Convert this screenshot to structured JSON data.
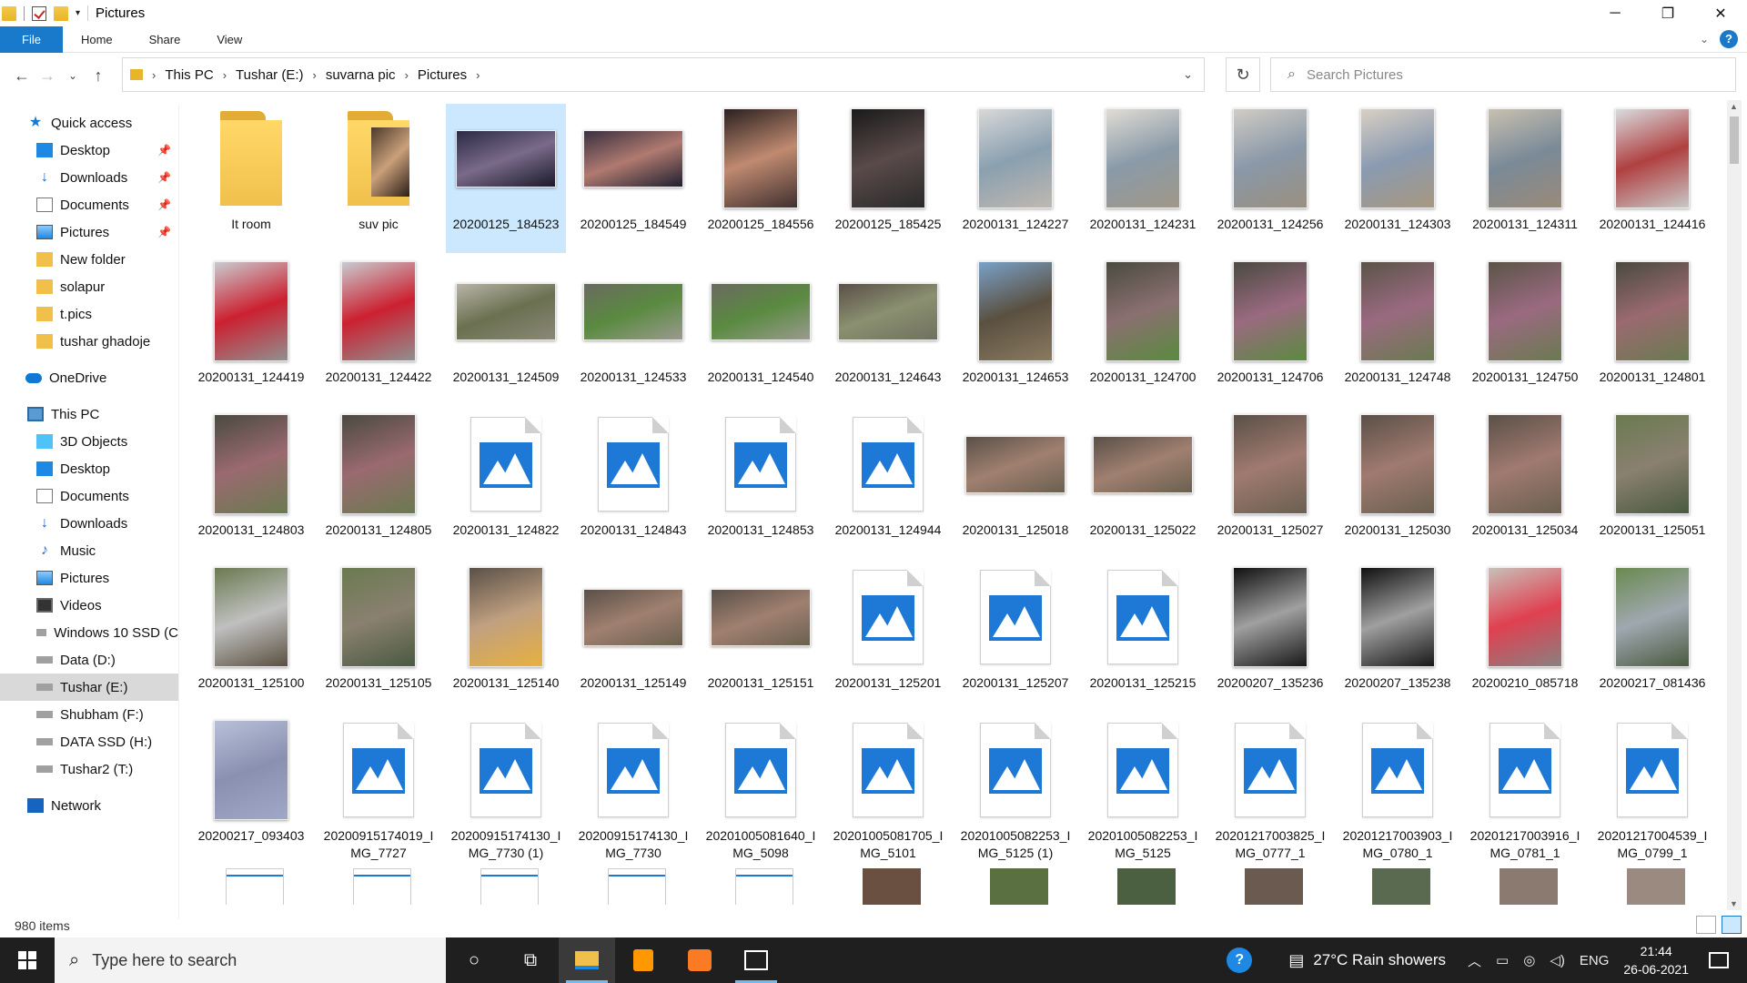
{
  "window": {
    "title": "Pictures",
    "controls": {
      "minimize": "─",
      "maximize": "❐",
      "close": "✕"
    }
  },
  "ribbon": {
    "tabs": [
      "File",
      "Home",
      "Share",
      "View"
    ]
  },
  "address": {
    "crumbs": [
      "This PC",
      "Tushar (E:)",
      "suvarna pic",
      "Pictures"
    ],
    "search_placeholder": "Search Pictures"
  },
  "sidebar": {
    "quick_access": "Quick access",
    "quick_items": [
      {
        "label": "Desktop",
        "icon": "desktop-icon",
        "pinned": true
      },
      {
        "label": "Downloads",
        "icon": "downloads-icon",
        "pinned": true
      },
      {
        "label": "Documents",
        "icon": "documents-icon",
        "pinned": true
      },
      {
        "label": "Pictures",
        "icon": "pictures-icon",
        "pinned": true
      },
      {
        "label": "New folder",
        "icon": "folder-icon",
        "pinned": false
      },
      {
        "label": "solapur",
        "icon": "folder-icon",
        "pinned": false
      },
      {
        "label": "t.pics",
        "icon": "folder-icon",
        "pinned": false
      },
      {
        "label": "tushar ghadoje",
        "icon": "folder-icon",
        "pinned": false
      }
    ],
    "onedrive": "OneDrive",
    "this_pc": "This PC",
    "pc_items": [
      {
        "label": "3D Objects",
        "icon": "3d-objects-icon"
      },
      {
        "label": "Desktop",
        "icon": "desktop-icon"
      },
      {
        "label": "Documents",
        "icon": "documents-icon"
      },
      {
        "label": "Downloads",
        "icon": "downloads-icon"
      },
      {
        "label": "Music",
        "icon": "music-icon"
      },
      {
        "label": "Pictures",
        "icon": "pictures-icon"
      },
      {
        "label": "Videos",
        "icon": "videos-icon"
      },
      {
        "label": "Windows 10 SSD (C",
        "icon": "drive-icon"
      },
      {
        "label": "Data (D:)",
        "icon": "drive-icon"
      },
      {
        "label": "Tushar (E:)",
        "icon": "drive-icon",
        "selected": true
      },
      {
        "label": "Shubham (F:)",
        "icon": "drive-icon"
      },
      {
        "label": "DATA SSD (H:)",
        "icon": "drive-icon"
      },
      {
        "label": "Tushar2 (T:)",
        "icon": "drive-icon"
      }
    ],
    "network": "Network"
  },
  "files": [
    {
      "name": "It room",
      "kind": "folder"
    },
    {
      "name": "suv pic",
      "kind": "folder-photo"
    },
    {
      "name": "20200125_184523",
      "kind": "l",
      "selected": true,
      "c": [
        "#2a2a45",
        "#7a6a8a",
        "#1a1a2a"
      ]
    },
    {
      "name": "20200125_184549",
      "kind": "l",
      "c": [
        "#3a3040",
        "#b07a70",
        "#202030"
      ]
    },
    {
      "name": "20200125_184556",
      "kind": "p",
      "c": [
        "#2a2020",
        "#c08a70",
        "#403030"
      ]
    },
    {
      "name": "20200125_185425",
      "kind": "p",
      "c": [
        "#1a1a1a",
        "#5a4a4a",
        "#2a2a2a"
      ]
    },
    {
      "name": "20200131_124227",
      "kind": "p",
      "c": [
        "#d8d8d8",
        "#8aa0b0",
        "#c0b8b0"
      ]
    },
    {
      "name": "20200131_124231",
      "kind": "p",
      "c": [
        "#e0dcd4",
        "#8a9aa8",
        "#a09888"
      ]
    },
    {
      "name": "20200131_124256",
      "kind": "p",
      "c": [
        "#d0ccc4",
        "#8a98a8",
        "#9a9080"
      ]
    },
    {
      "name": "20200131_124303",
      "kind": "p",
      "c": [
        "#d8d0c4",
        "#8a9ab0",
        "#a89880"
      ]
    },
    {
      "name": "20200131_124311",
      "kind": "p",
      "c": [
        "#c8c0b0",
        "#7a8a98",
        "#9a8a78"
      ]
    },
    {
      "name": "20200131_124416",
      "kind": "p",
      "c": [
        "#d8dce0",
        "#b04040",
        "#c8c8c8"
      ]
    },
    {
      "name": "20200131_124419",
      "kind": "p",
      "c": [
        "#c8ccd0",
        "#cc2030",
        "#909090"
      ]
    },
    {
      "name": "20200131_124422",
      "kind": "p",
      "c": [
        "#c8ccd0",
        "#cc2030",
        "#909090"
      ]
    },
    {
      "name": "20200131_124509",
      "kind": "l",
      "c": [
        "#b8b4a8",
        "#6a7050",
        "#8a8878"
      ]
    },
    {
      "name": "20200131_124533",
      "kind": "l",
      "c": [
        "#6a6a60",
        "#5a8a40",
        "#9a9a90"
      ]
    },
    {
      "name": "20200131_124540",
      "kind": "l",
      "c": [
        "#6a6a60",
        "#5a8a40",
        "#9a9a90"
      ]
    },
    {
      "name": "20200131_124643",
      "kind": "l",
      "c": [
        "#5a5048",
        "#8a9070",
        "#707060"
      ]
    },
    {
      "name": "20200131_124653",
      "kind": "p",
      "c": [
        "#7aa0c8",
        "#5a5040",
        "#8a7a60"
      ]
    },
    {
      "name": "20200131_124700",
      "kind": "p",
      "c": [
        "#4a4a40",
        "#8a7070",
        "#5a8a40"
      ]
    },
    {
      "name": "20200131_124706",
      "kind": "p",
      "c": [
        "#4a4a40",
        "#9a6a80",
        "#5a8a40"
      ]
    },
    {
      "name": "20200131_124748",
      "kind": "p",
      "c": [
        "#5a5448",
        "#9a6a80",
        "#6a7a50"
      ]
    },
    {
      "name": "20200131_124750",
      "kind": "p",
      "c": [
        "#5a5448",
        "#9a6a80",
        "#6a7a50"
      ]
    },
    {
      "name": "20200131_124801",
      "kind": "p",
      "c": [
        "#4a4a40",
        "#9a6a70",
        "#6a7a50"
      ]
    },
    {
      "name": "20200131_124803",
      "kind": "p",
      "c": [
        "#4a4a40",
        "#9a6a70",
        "#6a7a50"
      ]
    },
    {
      "name": "20200131_124805",
      "kind": "p",
      "c": [
        "#4a4a40",
        "#9a6a70",
        "#6a7a50"
      ]
    },
    {
      "name": "20200131_124822",
      "kind": "img"
    },
    {
      "name": "20200131_124843",
      "kind": "img"
    },
    {
      "name": "20200131_124853",
      "kind": "img"
    },
    {
      "name": "20200131_124944",
      "kind": "img"
    },
    {
      "name": "20200131_125018",
      "kind": "l",
      "c": [
        "#5a5048",
        "#a08070",
        "#6a6050"
      ]
    },
    {
      "name": "20200131_125022",
      "kind": "l",
      "c": [
        "#5a5048",
        "#a08070",
        "#6a6050"
      ]
    },
    {
      "name": "20200131_125027",
      "kind": "p",
      "c": [
        "#5a5048",
        "#a07a70",
        "#6a6050"
      ]
    },
    {
      "name": "20200131_125030",
      "kind": "p",
      "c": [
        "#5a5048",
        "#a07a70",
        "#6a6050"
      ]
    },
    {
      "name": "20200131_125034",
      "kind": "p",
      "c": [
        "#5a5048",
        "#a07a70",
        "#6a6050"
      ]
    },
    {
      "name": "20200131_125051",
      "kind": "p",
      "c": [
        "#6a7a50",
        "#8a8070",
        "#4a5a40"
      ]
    },
    {
      "name": "20200131_125100",
      "kind": "p",
      "c": [
        "#6a7a50",
        "#c0c0c0",
        "#5a5040"
      ]
    },
    {
      "name": "20200131_125105",
      "kind": "p",
      "c": [
        "#6a7a50",
        "#8a8070",
        "#4a5a40"
      ]
    },
    {
      "name": "20200131_125140",
      "kind": "p",
      "c": [
        "#5a5048",
        "#c0a080",
        "#e8b040"
      ]
    },
    {
      "name": "20200131_125149",
      "kind": "l",
      "c": [
        "#5a5048",
        "#a08070",
        "#6a6050"
      ]
    },
    {
      "name": "20200131_125151",
      "kind": "l",
      "c": [
        "#5a5048",
        "#a08070",
        "#6a6050"
      ]
    },
    {
      "name": "20200131_125201",
      "kind": "img"
    },
    {
      "name": "20200131_125207",
      "kind": "img"
    },
    {
      "name": "20200131_125215",
      "kind": "img"
    },
    {
      "name": "20200207_135236",
      "kind": "p",
      "c": [
        "#101010",
        "#a0a0a0",
        "#181818"
      ]
    },
    {
      "name": "20200207_135238",
      "kind": "p",
      "c": [
        "#101010",
        "#a0a0a0",
        "#181818"
      ]
    },
    {
      "name": "20200210_085718",
      "kind": "p",
      "c": [
        "#c8c0b8",
        "#e04050",
        "#8a8080"
      ]
    },
    {
      "name": "20200217_081436",
      "kind": "p",
      "c": [
        "#6a8a50",
        "#a0a8b0",
        "#4a5a40"
      ]
    },
    {
      "name": "20200217_093403",
      "kind": "p",
      "c": [
        "#b8c0d8",
        "#8a90b0",
        "#a0a8c8"
      ]
    },
    {
      "name": "20200915174019_IMG_7727",
      "kind": "img"
    },
    {
      "name": "20200915174130_IMG_7730 (1)",
      "kind": "img"
    },
    {
      "name": "20200915174130_IMG_7730",
      "kind": "img"
    },
    {
      "name": "20201005081640_IMG_5098",
      "kind": "img"
    },
    {
      "name": "20201005081705_IMG_5101",
      "kind": "img"
    },
    {
      "name": "20201005082253_IMG_5125 (1)",
      "kind": "img"
    },
    {
      "name": "20201005082253_IMG_5125",
      "kind": "img"
    },
    {
      "name": "20201217003825_IMG_0777_1",
      "kind": "img"
    },
    {
      "name": "20201217003903_IMG_0780_1",
      "kind": "img"
    },
    {
      "name": "20201217003916_IMG_0781_1",
      "kind": "img"
    },
    {
      "name": "20201217004539_IMG_0799_1",
      "kind": "img"
    }
  ],
  "status": {
    "items_count": "980 items"
  },
  "taskbar": {
    "search_placeholder": "Type here to search",
    "weather": "27°C  Rain showers",
    "lang": "ENG",
    "time": "21:44",
    "date": "26-06-2021"
  }
}
